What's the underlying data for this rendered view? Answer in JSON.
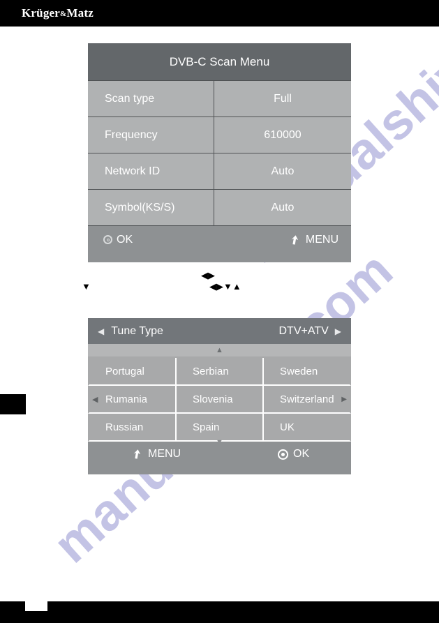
{
  "brand": {
    "name_before": "Kr",
    "name_full": "Krüger",
    "amp": "&",
    "name_after": "Matz"
  },
  "watermark": {
    "line_a": "manualshive.com",
    "line_b": "manualshive.com"
  },
  "scan_menu": {
    "title": "DVB-C Scan Menu",
    "rows": [
      {
        "label": "Scan type",
        "value": "Full"
      },
      {
        "label": "Frequency",
        "value": "610000"
      },
      {
        "label": "Network ID",
        "value": "Auto"
      },
      {
        "label": "Symbol(KS/S)",
        "value": "Auto"
      }
    ],
    "footer": {
      "ok_label": "OK",
      "ok_icon": "ok-ring-icon",
      "menu_label": "MENU",
      "menu_icon": "return-arrow-icon"
    }
  },
  "tune_menu": {
    "header": {
      "left_arrow": "◀",
      "label": "Tune Type",
      "value": "DTV+ATV",
      "right_arrow": "▶"
    },
    "scroll_up_icon": "▲",
    "scroll_down_icon": "▼",
    "nav_left_icon": "◀",
    "nav_right_icon": "▶",
    "countries": [
      [
        "Portugal",
        "Serbian",
        "Sweden"
      ],
      [
        "Rumania",
        "Slovenia",
        "Switzerland"
      ],
      [
        "Russian",
        "Spain",
        "UK"
      ]
    ],
    "footer": {
      "menu_label": "MENU",
      "menu_icon": "return-arrow-icon",
      "ok_label": "OK",
      "ok_icon": "ok-dot-icon"
    }
  },
  "loose_glyphs": {
    "down": "▼",
    "lr": "◀▶",
    "lrdu": "◀▶▼▲"
  },
  "colors": {
    "panel_header_dark": "#63676a",
    "panel_row": "#b0b2b3",
    "panel_footer": "#8e9193",
    "grid_cell": "#a8a9aa",
    "text": "#ffffff",
    "band": "#000000",
    "watermark": "#b3b3de"
  }
}
